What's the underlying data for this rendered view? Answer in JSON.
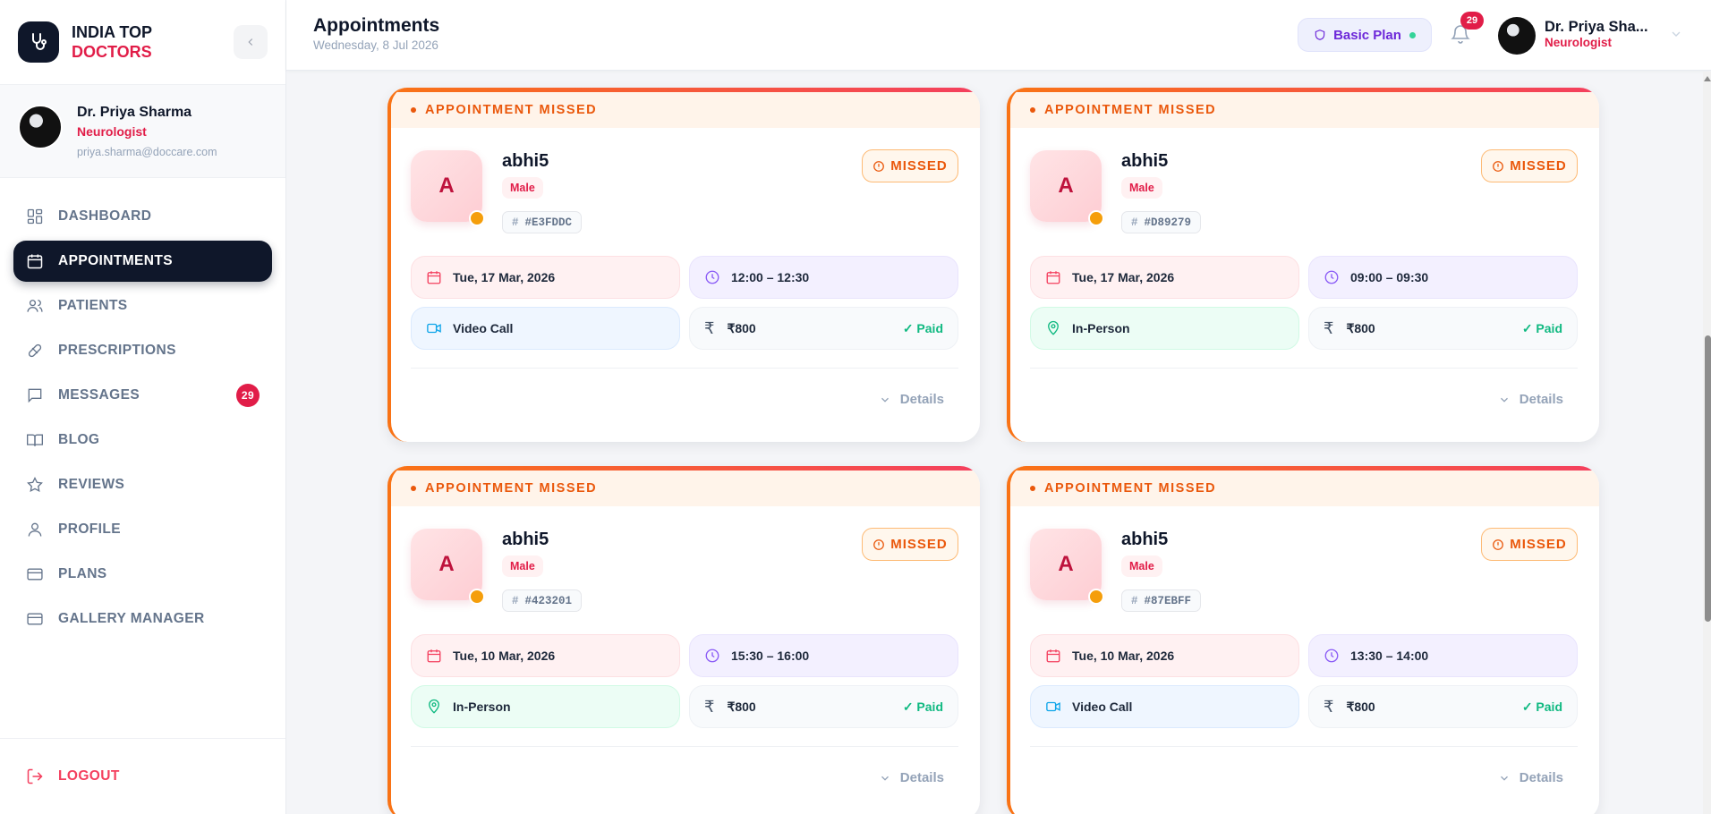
{
  "brand": {
    "line1": "INDIA TOP",
    "line2": "DOCTORS"
  },
  "profile": {
    "name": "Dr. Priya Sharma",
    "specialty": "Neurologist",
    "email": "priya.sharma@doccare.com"
  },
  "nav": [
    {
      "label": "DASHBOARD",
      "icon": "dashboard-icon"
    },
    {
      "label": "APPOINTMENTS",
      "icon": "calendar-icon",
      "active": true
    },
    {
      "label": "PATIENTS",
      "icon": "users-icon"
    },
    {
      "label": "PRESCRIPTIONS",
      "icon": "pill-icon"
    },
    {
      "label": "MESSAGES",
      "icon": "message-icon",
      "badge": "29"
    },
    {
      "label": "BLOG",
      "icon": "book-icon"
    },
    {
      "label": "REVIEWS",
      "icon": "star-icon"
    },
    {
      "label": "PROFILE",
      "icon": "user-icon"
    },
    {
      "label": "PLANS",
      "icon": "card-icon"
    },
    {
      "label": "GALLERY MANAGER",
      "icon": "card-icon"
    }
  ],
  "logout_label": "LOGOUT",
  "header": {
    "title": "Appointments",
    "date": "Wednesday, 8 Jul 2026",
    "plan": "Basic Plan",
    "notification_count": "29",
    "user_name": "Dr. Priya Sha...",
    "user_specialty": "Neurologist"
  },
  "cards": [
    {
      "banner": "APPOINTMENT MISSED",
      "initial": "A",
      "name": "abhi5",
      "gender": "Male",
      "id": "#E3FDDC",
      "status": "MISSED",
      "date": "Tue, 17 Mar, 2026",
      "time": "12:00 – 12:30",
      "mode": "Video Call",
      "mode_icon": "video-icon",
      "fee": "₹800",
      "payment": "✓ Paid",
      "details": "Details"
    },
    {
      "banner": "APPOINTMENT MISSED",
      "initial": "A",
      "name": "abhi5",
      "gender": "Male",
      "id": "#D89279",
      "status": "MISSED",
      "date": "Tue, 17 Mar, 2026",
      "time": "09:00 – 09:30",
      "mode": "In-Person",
      "mode_icon": "location-pin-icon",
      "fee": "₹800",
      "payment": "✓ Paid",
      "details": "Details"
    },
    {
      "banner": "APPOINTMENT MISSED",
      "initial": "A",
      "name": "abhi5",
      "gender": "Male",
      "id": "#423201",
      "status": "MISSED",
      "date": "Tue, 10 Mar, 2026",
      "time": "15:30 – 16:00",
      "mode": "In-Person",
      "mode_icon": "location-pin-icon",
      "fee": "₹800",
      "payment": "✓ Paid",
      "details": "Details"
    },
    {
      "banner": "APPOINTMENT MISSED",
      "initial": "A",
      "name": "abhi5",
      "gender": "Male",
      "id": "#87EBFF",
      "status": "MISSED",
      "date": "Tue, 10 Mar, 2026",
      "time": "13:30 – 14:00",
      "mode": "Video Call",
      "mode_icon": "video-icon",
      "fee": "₹800",
      "payment": "✓ Paid",
      "details": "Details"
    }
  ],
  "colors": {
    "accent": "#e11d48",
    "dark": "#0f172a",
    "missed": "#ea580c",
    "paid": "#10b981"
  }
}
